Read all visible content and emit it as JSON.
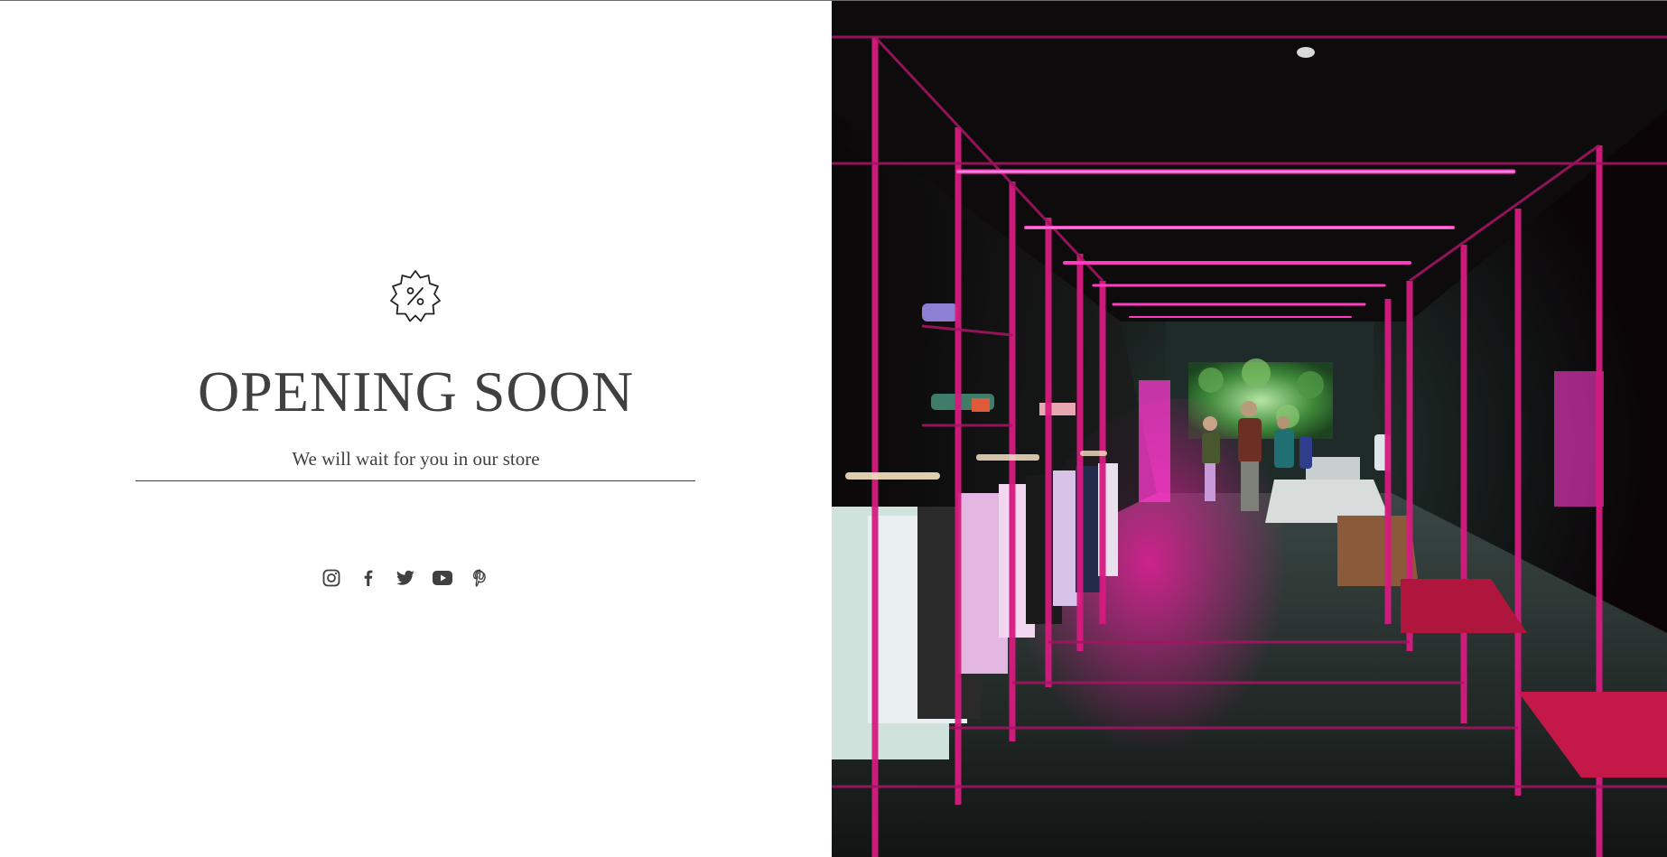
{
  "hero": {
    "badge_icon": "discount-badge-icon",
    "title": "OPENING SOON",
    "subtitle": "We will wait for you in our store"
  },
  "social": [
    {
      "name": "instagram",
      "icon": "instagram-icon"
    },
    {
      "name": "facebook",
      "icon": "facebook-icon"
    },
    {
      "name": "twitter",
      "icon": "twitter-icon"
    },
    {
      "name": "youtube",
      "icon": "youtube-icon"
    },
    {
      "name": "pinterest",
      "icon": "pinterest-icon"
    }
  ],
  "colors": {
    "text": "#404040",
    "background": "#ffffff",
    "neon": "#ff2aa8",
    "store_dark": "#0b0508"
  },
  "image": {
    "subject": "store-interior-photo"
  }
}
